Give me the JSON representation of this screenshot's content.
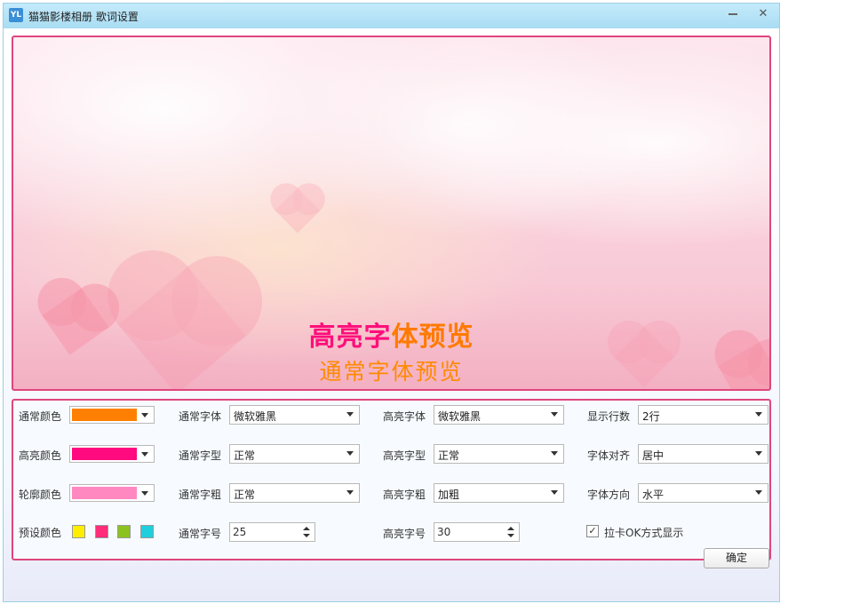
{
  "window": {
    "app_icon": "YL",
    "title": "猫猫影楼相册  歌词设置"
  },
  "preview": {
    "highlight_part1": "高亮字",
    "highlight_part2": "体预览",
    "normal_text": "通常字体预览"
  },
  "settings": {
    "normal_color": {
      "label": "通常颜色",
      "color": "#ff8000"
    },
    "highlight_color": {
      "label": "高亮颜色",
      "color": "#ff0a7f"
    },
    "outline_color": {
      "label": "轮廓颜色",
      "color": "#ff88c0"
    },
    "preset_colors": {
      "label": "预设颜色",
      "colors": [
        "#ffee00",
        "#ff2d7a",
        "#8cc21f",
        "#1fd0dc"
      ]
    },
    "normal_font": {
      "label": "通常字体",
      "value": "微软雅黑"
    },
    "normal_style": {
      "label": "通常字型",
      "value": "正常"
    },
    "normal_weight": {
      "label": "通常字粗",
      "value": "正常"
    },
    "normal_size": {
      "label": "通常字号",
      "value": "25"
    },
    "highlight_font": {
      "label": "高亮字体",
      "value": "微软雅黑"
    },
    "highlight_style": {
      "label": "高亮字型",
      "value": "正常"
    },
    "highlight_weight": {
      "label": "高亮字粗",
      "value": "加粗"
    },
    "highlight_size": {
      "label": "高亮字号",
      "value": "30"
    },
    "display_lines": {
      "label": "显示行数",
      "value": "2行"
    },
    "font_align": {
      "label": "字体对齐",
      "value": "居中"
    },
    "font_direction": {
      "label": "字体方向",
      "value": "水平"
    },
    "karaoke": {
      "label": "拉卡OK方式显示",
      "checked": true
    }
  },
  "footer": {
    "ok_label": "确定"
  }
}
